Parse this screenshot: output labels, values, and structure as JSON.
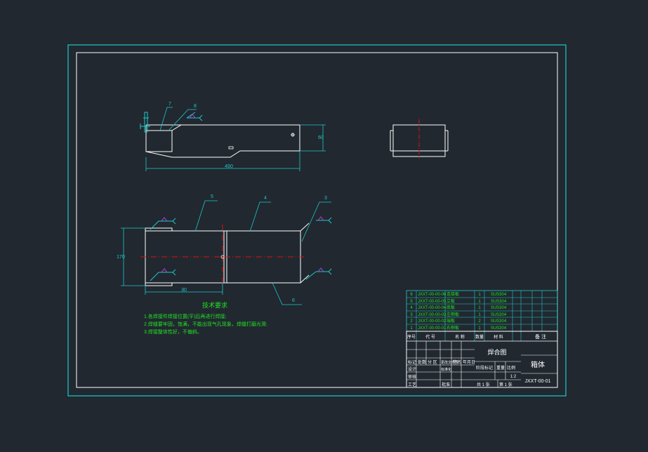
{
  "colors": {
    "background": "#212830",
    "sheet_border": "#1ec8c8",
    "inner_border": "#ffffff",
    "outline": "#ffffff",
    "dimension": "#1ec8c8",
    "centerline": "#e01010",
    "notes": "#22e022",
    "table_text": "#22e022",
    "weld_symbol": "#c040e0"
  },
  "views": {
    "front_view": {
      "dim_length": "490",
      "dim_height": "60",
      "balloons": [
        "7",
        "8"
      ]
    },
    "top_view": {
      "dim_width": "170",
      "dim_offset": "30",
      "balloons": [
        "5",
        "4",
        "3",
        "6"
      ]
    }
  },
  "technical_requirements": {
    "heading": "技术要求",
    "lines": [
      "1.各焊接件焊接位置(平)后再进行焊接;",
      "2.焊缝要牢固，饱满，不能出现气孔现象，焊缝打磨光滑;",
      "3.焊接整体性好，不偏斜。"
    ]
  },
  "parts_list": {
    "rows": [
      {
        "no": "6",
        "code": "JXXT-00-00-06",
        "name": "连接板",
        "qty": "1",
        "material": "SUS304"
      },
      {
        "no": "5",
        "code": "JXXT-00-00-05",
        "name": "立板",
        "qty": "1",
        "material": "SUS304"
      },
      {
        "no": "4",
        "code": "JXXT-00-00-04",
        "name": "底板",
        "qty": "1",
        "material": "SUS304"
      },
      {
        "no": "3",
        "code": "JXXT-00-00-03",
        "name": "左侧板",
        "qty": "1",
        "material": "SUS304"
      },
      {
        "no": "2",
        "code": "JXXT-00-00-02",
        "name": "端板",
        "qty": "2",
        "material": "SUS304"
      },
      {
        "no": "1",
        "code": "JXXT-00-00-01",
        "name": "右侧板",
        "qty": "1",
        "material": "SUS304"
      }
    ],
    "header": {
      "no": "序号",
      "code": "代 号",
      "name": "名 称",
      "qty": "数量",
      "material": "材 料",
      "remark": "备 注"
    }
  },
  "title_block": {
    "drawing_type": "焊合图",
    "part_name": "箱体",
    "drawing_number": "JXXT-00-01",
    "scale_label": "比例",
    "scale": "1:2",
    "stage_label": "阶段标记",
    "weight_label": "重量",
    "sheet_total": "共 1 张",
    "sheet_no": "第 1 张",
    "labels": {
      "mark": "标记",
      "count": "处数",
      "zone": "分 区",
      "change_doc": "更改文件号",
      "sign": "签名",
      "date": "年月日",
      "design": "设计",
      "standard": "标准化",
      "review": "审核",
      "process": "工艺",
      "approve": "批准"
    }
  }
}
